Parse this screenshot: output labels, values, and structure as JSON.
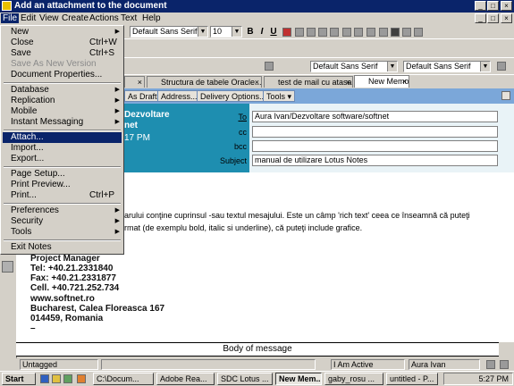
{
  "window": {
    "title": "Add an attachment to the document"
  },
  "menubar": {
    "items": [
      "File",
      "Edit",
      "View",
      "Create",
      "Actions",
      "Text",
      "Help"
    ]
  },
  "toolbar": {
    "font_combo": "Default Sans Serif",
    "size_combo": "10",
    "buttons": [
      "B",
      "I",
      "U"
    ]
  },
  "toolbar2": {
    "combo1": "Default Sans Serif",
    "combo2": "Default Sans Serif"
  },
  "tabs": [
    {
      "label": "Structura de tabele Oracle..."
    },
    {
      "label": "test de mail cu atasament"
    },
    {
      "label": "New Memo"
    }
  ],
  "actionbar": {
    "draft": "As Draft",
    "address": "Address...",
    "delivery": "Delivery Options...",
    "tools": "Tools"
  },
  "header": {
    "sender_line1": "Dezvoltare",
    "sender_line2": "net",
    "time": "17 PM",
    "to_label": "To",
    "to_value": "Aura Ivan/Dezvoltare software/softnet",
    "cc_label": "cc",
    "cc_value": "",
    "bcc_label": "bcc",
    "bcc_value": "",
    "subject_label": "Subject",
    "subject_value": "manual de utilizare Lotus Notes"
  },
  "body": {
    "line1": "arului conţine cuprinsul -sau textul mesajului.  Este un câmp 'rich text' ceea ce înseamnă că puteţi",
    "line2": "rmat (de exemplu bold, italic si underline), că puteţi include grafice.",
    "signature": [
      "Project Manager",
      "Tel: +40.21.2331840",
      "Fax: +40.21.2331877",
      "Cell. +40.721.252.734",
      "www.softnet.ro",
      "Bucharest, Calea Floreasca 167",
      "014459, Romania",
      "–"
    ],
    "section_label": "Body of message"
  },
  "statusbar": {
    "untagged": "Untagged",
    "status": "I Am Active",
    "user": "Aura Ivan"
  },
  "taskbar": {
    "start": "Start",
    "tasks": [
      "C:\\Docum...",
      "Adobe Rea...",
      "SDC Lotus ...",
      "New Mem...",
      "gaby_rosu ...",
      "untitled - P..."
    ],
    "clock": "5:27 PM"
  },
  "file_menu": {
    "items": [
      {
        "label": "New",
        "shortcut": "",
        "submenu": true,
        "disabled": false
      },
      {
        "label": "Close",
        "shortcut": "Ctrl+W",
        "submenu": false,
        "disabled": false
      },
      {
        "label": "Save",
        "shortcut": "Ctrl+S",
        "submenu": false,
        "disabled": false
      },
      {
        "label": "Save As New Version",
        "shortcut": "",
        "submenu": false,
        "disabled": true
      },
      {
        "label": "Document Properties...",
        "shortcut": "",
        "submenu": false,
        "disabled": false
      },
      {
        "label": "Database",
        "shortcut": "",
        "submenu": true,
        "disabled": false
      },
      {
        "label": "Replication",
        "shortcut": "",
        "submenu": true,
        "disabled": false
      },
      {
        "label": "Mobile",
        "shortcut": "",
        "submenu": true,
        "disabled": false
      },
      {
        "label": "Instant Messaging",
        "shortcut": "",
        "submenu": true,
        "disabled": false
      },
      {
        "label": "Attach...",
        "shortcut": "",
        "submenu": false,
        "disabled": false,
        "selected": true
      },
      {
        "label": "Import...",
        "shortcut": "",
        "submenu": false,
        "disabled": false
      },
      {
        "label": "Export...",
        "shortcut": "",
        "submenu": false,
        "disabled": false
      },
      {
        "label": "Page Setup...",
        "shortcut": "",
        "submenu": false,
        "disabled": false
      },
      {
        "label": "Print Preview...",
        "shortcut": "",
        "submenu": false,
        "disabled": false
      },
      {
        "label": "Print...",
        "shortcut": "Ctrl+P",
        "submenu": false,
        "disabled": false
      },
      {
        "label": "Preferences",
        "shortcut": "",
        "submenu": true,
        "disabled": false
      },
      {
        "label": "Security",
        "shortcut": "",
        "submenu": true,
        "disabled": false
      },
      {
        "label": "Tools",
        "shortcut": "",
        "submenu": true,
        "disabled": false
      },
      {
        "label": "Exit Notes",
        "shortcut": "",
        "submenu": false,
        "disabled": false
      }
    ]
  },
  "colors": {
    "titlebar": "#0a246a",
    "actionbar": "#7ba7d9",
    "header_band": "#1e8eb0",
    "menu_selection": "#0a246a"
  }
}
